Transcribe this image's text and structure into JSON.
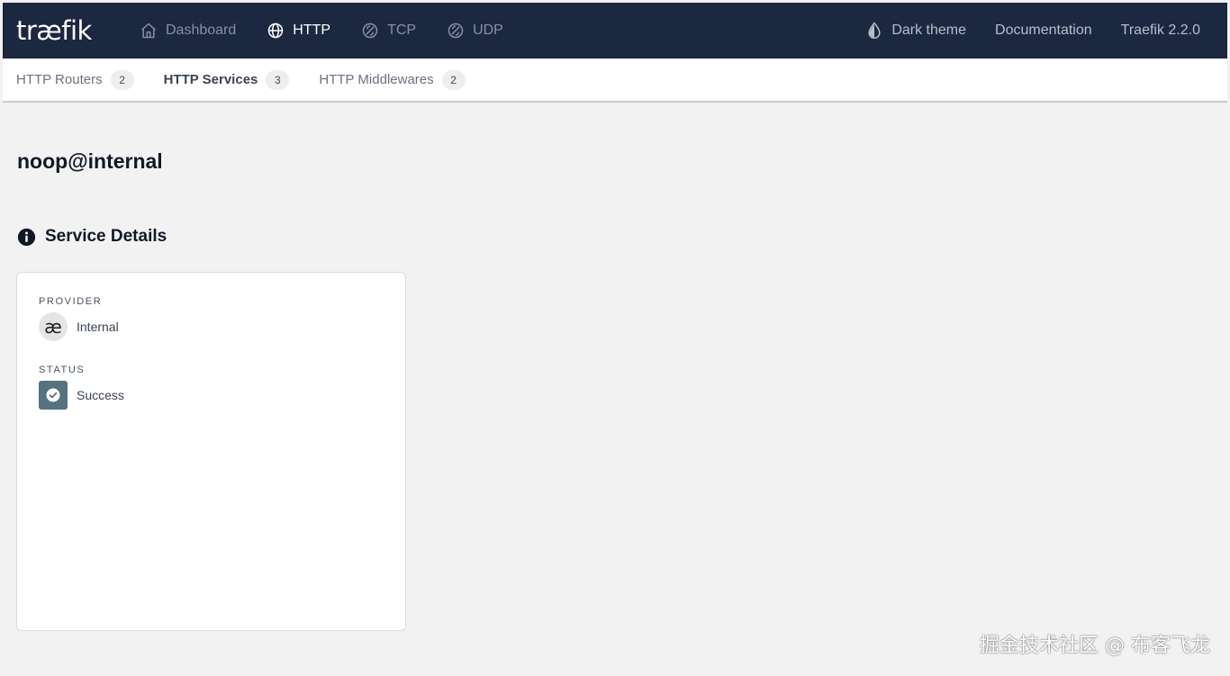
{
  "navbar": {
    "logo": "træfik",
    "items": [
      {
        "label": "Dashboard",
        "icon": "home-icon"
      },
      {
        "label": "HTTP",
        "icon": "globe-icon"
      },
      {
        "label": "TCP",
        "icon": "tcp-icon"
      },
      {
        "label": "UDP",
        "icon": "udp-icon"
      }
    ],
    "dark_theme": "Dark theme",
    "documentation": "Documentation",
    "version": "Traefik 2.2.0"
  },
  "subtabs": [
    {
      "label": "HTTP Routers",
      "count": "2"
    },
    {
      "label": "HTTP Services",
      "count": "3"
    },
    {
      "label": "HTTP Middlewares",
      "count": "2"
    }
  ],
  "page": {
    "title": "noop@internal",
    "section_title": "Service Details"
  },
  "card": {
    "provider_label": "PROVIDER",
    "provider_value": "Internal",
    "provider_icon_glyph": "æ",
    "status_label": "STATUS",
    "status_value": "Success"
  },
  "watermark": "掘金技术社区 @ 布客飞龙",
  "colors": {
    "navbar_bg": "#1c2740",
    "status_bg": "#567180",
    "page_bg": "#f2f2f2"
  }
}
